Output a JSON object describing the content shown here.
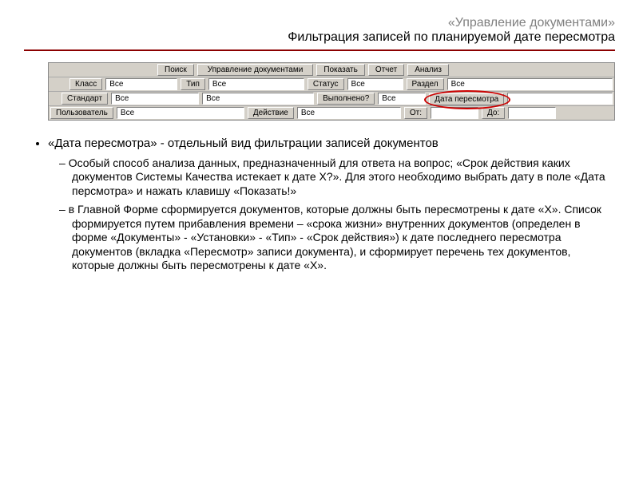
{
  "header": {
    "title": "«Управление документами»",
    "subtitle": "Фильтрация записей по планируемой дате пересмотра"
  },
  "toolbar": {
    "row1": {
      "search": "Поиск",
      "mgmt": "Управление документами",
      "show": "Показать",
      "report": "Отчет",
      "analysis": "Анализ"
    },
    "row2": {
      "class_lbl": "Класс",
      "class_val": "Все",
      "type_lbl": "Тип",
      "type_val": "Все",
      "status_lbl": "Статус",
      "status_val": "Все",
      "section_lbl": "Раздел",
      "section_val": "Все"
    },
    "row3": {
      "std_lbl": "Стандарт",
      "std_val": "Все",
      "name_val": "Все",
      "done_lbl": "Выполнено?",
      "done_val": "Все",
      "review_lbl": "Дата пересмотра",
      "review_val": ""
    },
    "row4": {
      "user_lbl": "Пользователь",
      "user_val": "Все",
      "action_lbl": "Действие",
      "action_val": "Все",
      "from_lbl": "От:",
      "from_val": "",
      "to_lbl": "До:",
      "to_val": ""
    }
  },
  "body": {
    "bullet1": "«Дата пересмотра»  - отдельный вид фильтрации записей документов",
    "sub1": "Особый способ анализа данных, предназначенный  для ответа на вопрос; «Срок действия каких документов Системы Качества истекает к дате Х?». Для этого необходимо выбрать дату в поле «Дата персмотра» и нажать клавишу «Показать!»",
    "sub2": "в Главной Форме сформируется документов, которые должны быть пересмотрены к дате «Х». Список формируется путем прибавления времени – «срока жизни» внутренних документов (определен в форме «Документы» - «Установки» - «Тип» - «Срок действия»)  к дате последнего пересмотра документов (вкладка «Пересмотр» записи документа), и сформирует перечень тех документов, которые должны быть пересмотрены к дате «Х»."
  }
}
